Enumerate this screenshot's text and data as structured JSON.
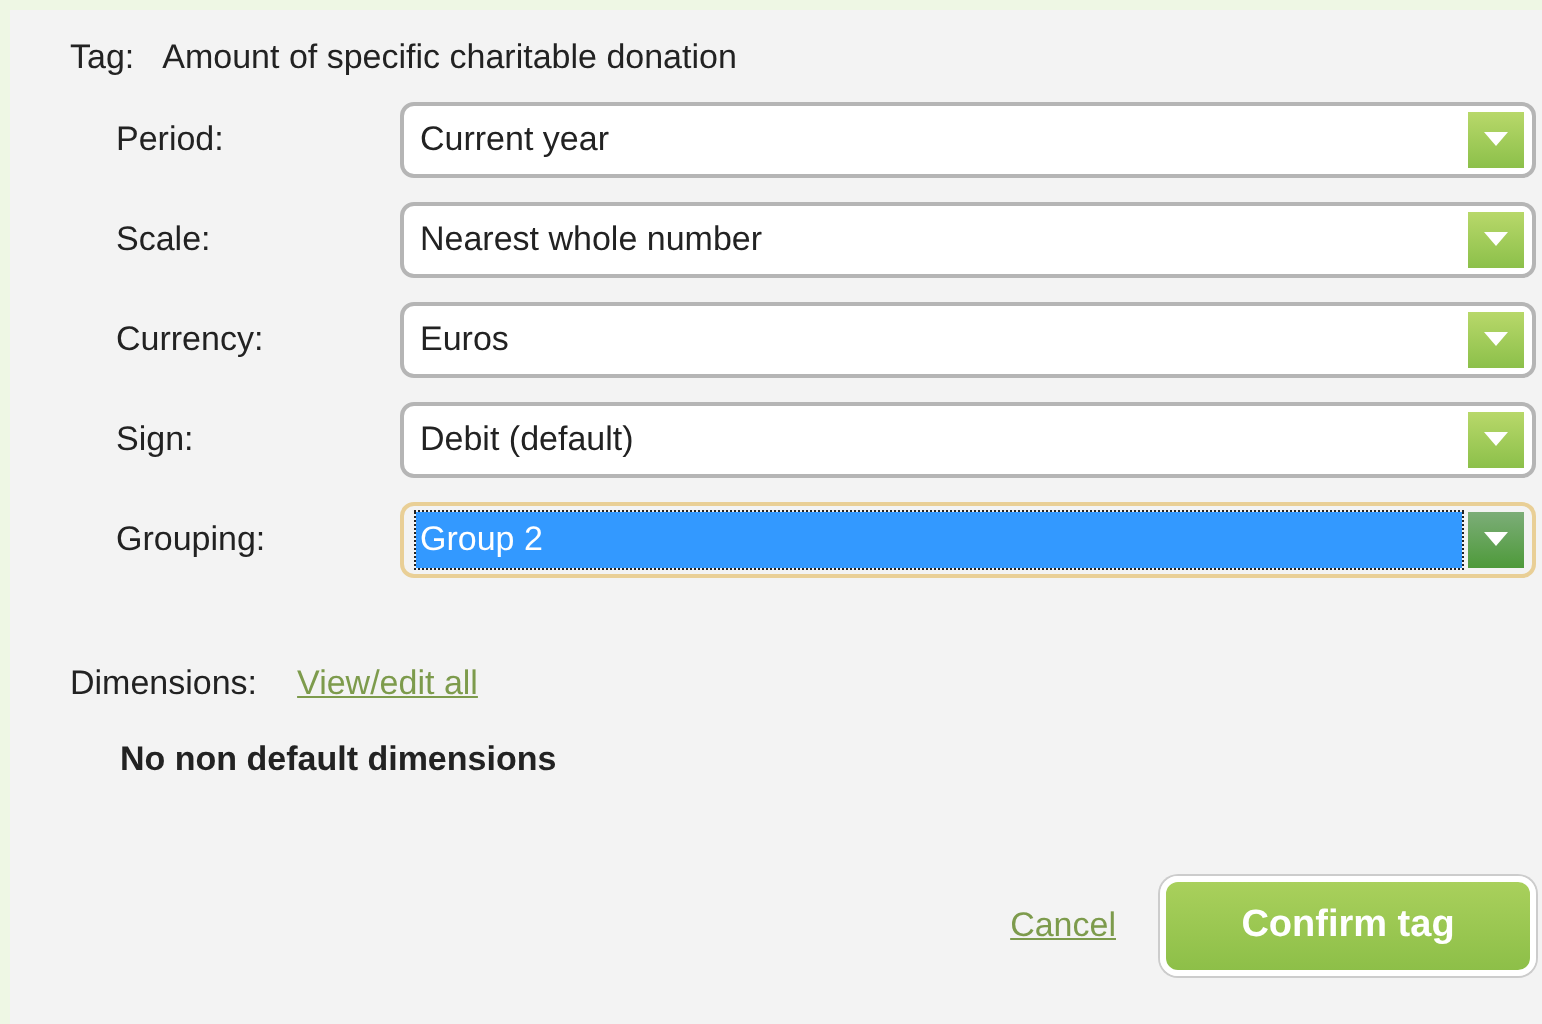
{
  "tag": {
    "label": "Tag:",
    "value": "Amount of specific charitable donation"
  },
  "fields": [
    {
      "label": "Period:",
      "value": "Current year",
      "focused": false
    },
    {
      "label": "Scale:",
      "value": "Nearest whole number",
      "focused": false
    },
    {
      "label": "Currency:",
      "value": "Euros",
      "focused": false
    },
    {
      "label": "Sign:",
      "value": "Debit (default)",
      "focused": false
    },
    {
      "label": "Grouping:",
      "value": "Group 2",
      "focused": true
    }
  ],
  "dimensions": {
    "label": "Dimensions:",
    "link": "View/edit all",
    "message": "No non default dimensions"
  },
  "buttons": {
    "cancel": "Cancel",
    "confirm": "Confirm tag"
  }
}
